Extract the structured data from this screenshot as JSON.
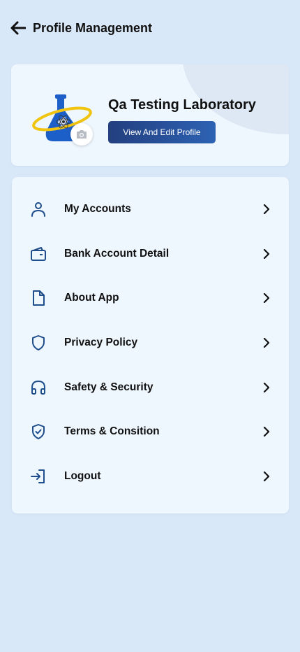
{
  "header": {
    "title": "Profile Management"
  },
  "profile": {
    "name": "Qa Testing Laboratory",
    "edit_label": "View And Edit Profile"
  },
  "menu": {
    "items": [
      {
        "label": "My Accounts",
        "icon": "user-icon"
      },
      {
        "label": "Bank Account Detail",
        "icon": "wallet-icon"
      },
      {
        "label": "About App",
        "icon": "document-icon"
      },
      {
        "label": "Privacy Policy",
        "icon": "shield-icon"
      },
      {
        "label": "Safety & Security",
        "icon": "headphones-icon"
      },
      {
        "label": "Terms & Consition",
        "icon": "shield-check-icon"
      },
      {
        "label": "Logout",
        "icon": "logout-icon"
      }
    ]
  },
  "colors": {
    "background": "#d9e8f8",
    "card": "#eef6fe",
    "accent": "#1e4e8c",
    "button_start": "#233f7f",
    "button_end": "#2d62b3"
  }
}
